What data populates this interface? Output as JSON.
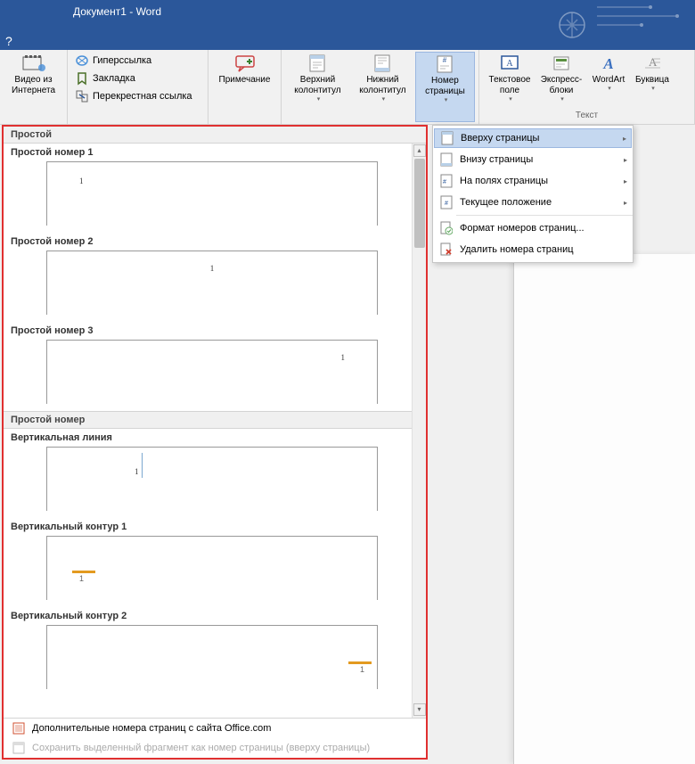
{
  "titlebar": {
    "title": "Документ1 - Word",
    "help": "?"
  },
  "ribbon": {
    "video": {
      "label": "Видео из\nИнтернета"
    },
    "links": {
      "hyperlink": "Гиперссылка",
      "bookmark": "Закладка",
      "crossref": "Перекрестная ссылка"
    },
    "comment": {
      "label": "Примечание"
    },
    "headerfooter": {
      "header": "Верхний\nколонтитул",
      "footer": "Нижний\nколонтитул",
      "pagenum": "Номер\nстраницы"
    },
    "text": {
      "textbox": "Текстовое\nполе",
      "quickparts": "Экспресс-\nблоки",
      "wordart": "WordArt",
      "dropcap": "Буквица",
      "group_label": "Текст"
    }
  },
  "menu": {
    "top": "Вверху страницы",
    "bottom": "Внизу страницы",
    "margins": "На полях страницы",
    "current": "Текущее положение",
    "format": "Формат номеров страниц...",
    "remove": "Удалить номера страниц"
  },
  "gallery": {
    "header1": "Простой",
    "items": [
      {
        "title": "Простой номер 1",
        "pos": "left",
        "num": "1"
      },
      {
        "title": "Простой номер 2",
        "pos": "center",
        "num": "1"
      },
      {
        "title": "Простой номер 3",
        "pos": "right",
        "num": "1"
      }
    ],
    "header2": "Простой номер",
    "items2": [
      {
        "title": "Вертикальная линия",
        "type": "vline",
        "num": "1"
      },
      {
        "title": "Вертикальный контур 1",
        "type": "vfield-left",
        "num": "1"
      },
      {
        "title": "Вертикальный контур 2",
        "type": "vfield-right",
        "num": "1"
      }
    ],
    "footer": {
      "more": "Дополнительные номера страниц с сайта Office.com",
      "save": "Сохранить выделенный фрагмент как номер страницы (вверху страницы)"
    }
  }
}
